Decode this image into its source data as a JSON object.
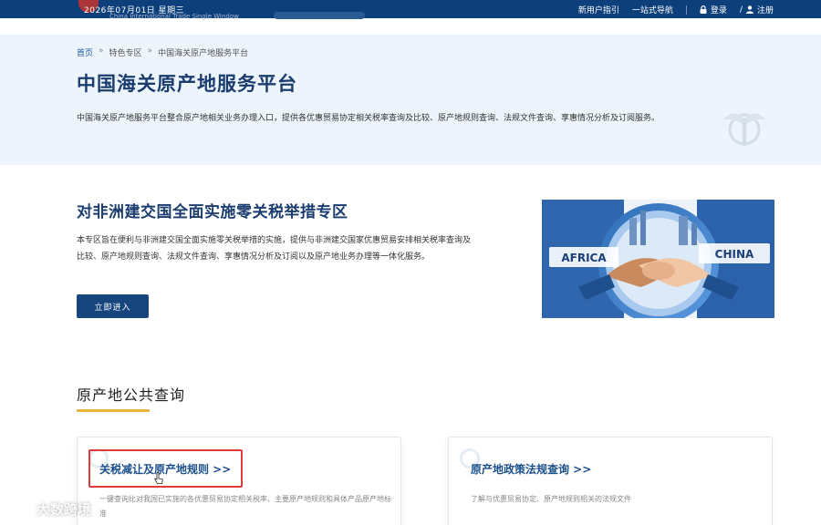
{
  "topbar": {
    "date": "2026年07月01日 星期三",
    "site_english": "China International Trade Single Window",
    "links": [
      "新用户指引",
      "一站式导航"
    ],
    "login": "登录",
    "register": "注册"
  },
  "breadcrumb": [
    "首页",
    "特色专区",
    "中国海关原产地服务平台"
  ],
  "hero": {
    "title": "中国海关原产地服务平台",
    "description": "中国海关原产地服务平台整合原产地相关业务办理入口，提供各优惠贸易协定相关税率查询及比较、原产地规则查询、法规文件查询、享惠情况分析及订阅服务。"
  },
  "special": {
    "title": "对非洲建交国全面实施零关税举措专区",
    "description": "本专区旨在便利与非洲建交国全面实施零关税举措的实施，提供与非洲建交国家优惠贸易安排相关税率查询及比较、原产地规则查询、法规文件查询、享惠情况分析及订阅以及原产地业务办理等一体化服务。",
    "enter_label": "立即进入",
    "banner_left": "AFRICA",
    "banner_right": "CHINA"
  },
  "query": {
    "title": "原产地公共查询",
    "cards": [
      {
        "title": "关税减让及原产地规则 >>",
        "description": "一键查询比对我国已实施的各优惠贸易协定相关税率、主要原产地规则和具体产品原产地标准"
      },
      {
        "title": "原产地政策法规查询 >>",
        "description": "了解与优惠贸易协定、原产地规则相关的法规文件"
      }
    ]
  },
  "watermark": "大数跨境",
  "colors": {
    "topbar": "#0d3f7a",
    "title_blue": "#1a3c6e",
    "button_blue": "#17467f",
    "highlight_red": "#e03a3a",
    "underline_gold": "#e8b640"
  }
}
